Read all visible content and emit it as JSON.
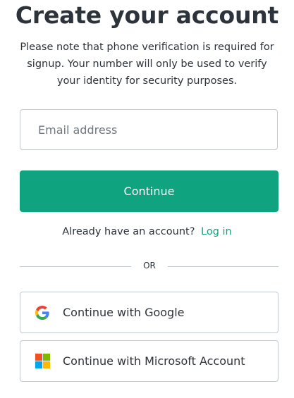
{
  "page": {
    "title": "Create your account",
    "subtitle": "Please note that phone verification is required for signup. Your number will only be used to verify your identity for security purposes."
  },
  "form": {
    "email_placeholder": "Email address",
    "email_value": "",
    "continue_label": "Continue"
  },
  "login": {
    "prompt": "Already have an account?",
    "link_label": "Log in"
  },
  "divider": {
    "label": "OR"
  },
  "social": {
    "google_label": "Continue with Google",
    "google_icon": "google-icon",
    "microsoft_label": "Continue with Microsoft Account",
    "microsoft_icon": "microsoft-icon"
  },
  "colors": {
    "accent": "#10a37f",
    "text": "#2d333a",
    "border": "#c2c8d0",
    "google_blue": "#4285f4",
    "google_red": "#ea4335",
    "google_yellow": "#fbbc05",
    "google_green": "#34a853",
    "ms_red": "#f25022",
    "ms_green": "#7fba00",
    "ms_blue": "#00a4ef",
    "ms_yellow": "#ffb900"
  }
}
